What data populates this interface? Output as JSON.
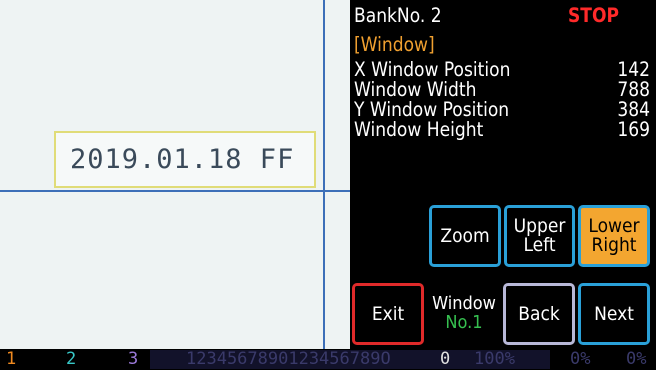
{
  "camera": {
    "window_text": "2019.01.18 FF"
  },
  "panel": {
    "bank": "BankNo. 2",
    "status": "STOP",
    "section": "[Window]",
    "rows": [
      {
        "label": "X Window Position",
        "value": "142"
      },
      {
        "label": "Window Width",
        "value": "788"
      },
      {
        "label": "Y Window Position",
        "value": "384"
      },
      {
        "label": "Window Height",
        "value": "169"
      }
    ],
    "buttons": {
      "zoom": "Zoom",
      "upper_left_1": "Upper",
      "upper_left_2": "Left",
      "lower_right_1": "Lower",
      "lower_right_2": "Right",
      "exit": "Exit",
      "back": "Back",
      "next": "Next"
    },
    "window_label": "Window",
    "window_number": "No.1"
  },
  "statusbar": {
    "ch1": "1",
    "ch2": "2",
    "ch3": "3",
    "digits": "1234567890123456789O",
    "zero": "0",
    "pct1": "100%",
    "pct2": "0%",
    "pct3": "0%"
  },
  "colors": {
    "accent_active": "#f3a630",
    "button_border": "#2aa0d8",
    "exit_border": "#e02a2a",
    "stop": "#ff2a2a",
    "section": "#f0a030",
    "window_number": "#36c050"
  }
}
